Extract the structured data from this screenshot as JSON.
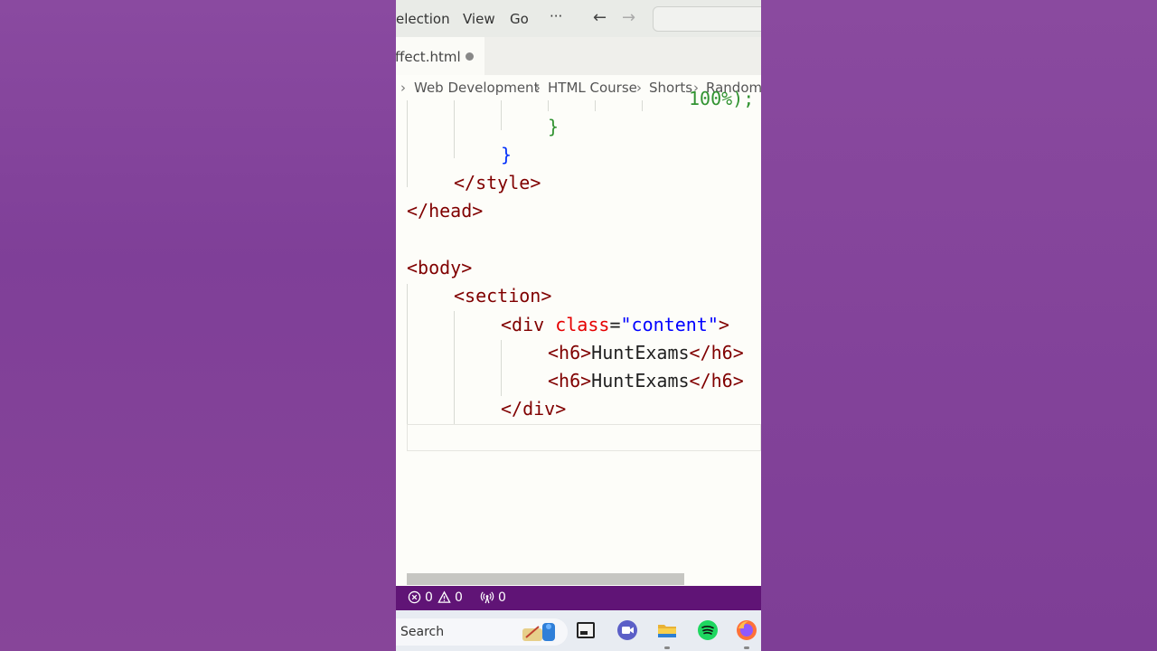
{
  "menubar": {
    "items": [
      "election",
      "View",
      "Go",
      "···"
    ],
    "back_icon": "←",
    "forward_icon": "→"
  },
  "tab": {
    "label": "ffect.html"
  },
  "breadcrumbs": [
    "Web Development",
    "HTML Course",
    "Shorts",
    "Random"
  ],
  "code_lines": {
    "l0": "100%);",
    "l1": "}",
    "l2": "}",
    "l3_open": "</",
    "l3_tag": "style",
    "l3_close": ">",
    "l4": "</head>",
    "l6": "<body>",
    "l7": "<section>",
    "l8_a": "<div ",
    "l8_attr": "class",
    "l8_eq": "=",
    "l8_str": "\"content\"",
    "l8_b": ">",
    "l9_open": "<h6>",
    "l9_text": "HuntExams",
    "l9_close": "</h6>",
    "l10_open": "<h6>",
    "l10_text": "HuntExams",
    "l10_close": "</h6>",
    "l11": "</div>"
  },
  "statusbar": {
    "errors": "0",
    "warnings": "0",
    "ports": "0"
  },
  "taskbar": {
    "search_label": "Search",
    "icons": [
      "widgets-icon",
      "terminal-icon",
      "teams-icon",
      "file-explorer-icon",
      "spotify-icon",
      "firefox-icon"
    ]
  },
  "colors": {
    "background": "#824299",
    "statusbar": "#601476",
    "tag": "#800000",
    "attr": "#e50000",
    "string": "#0000ff"
  }
}
